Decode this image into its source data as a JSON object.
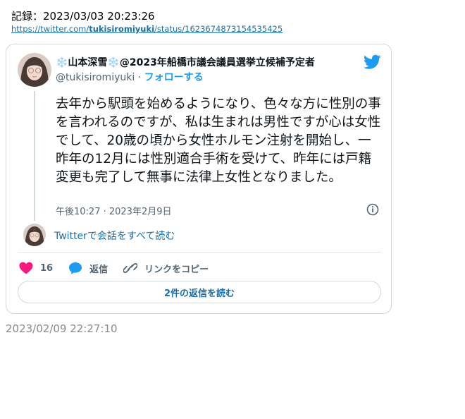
{
  "record": {
    "label": "記録：2023/03/03 20:23:26",
    "url_prefix": "https://twitter.com/",
    "url_user": "tukisiromiyuki",
    "url_suffix": "/status/1623674873154535425"
  },
  "tweet": {
    "display_name": "❄️山本深雪❄️@2023年船橋市議会議員選挙立候補予定者",
    "handle": "@tukisiromiyuki",
    "separator": " · ",
    "follow_label": "フォローする",
    "text": "去年から駅頭を始めるようになり、色々な方に性別の事を言われるのですが、私は生まれは男性ですが心は女性でして、20歳の頃から女性ホルモン注射を開始し、一昨年の12月には性別適合手術を受けて、昨年には戸籍変更も完了して無事に法律上女性となりました。",
    "timestamp": "午後10:27 · 2023年2月9日",
    "read_conversation": "Twitterで会話をすべて読む",
    "likes": "16",
    "reply_label": "返信",
    "copy_link_label": "リンクをコピー",
    "read_replies": "2件の返信を読む"
  },
  "footer_timestamp": "2023/02/09 22:27:10",
  "colors": {
    "accent": "#1d9bf0",
    "like": "#f91880",
    "link": "#1b6ea8"
  },
  "icons": [
    "twitter-bird-icon",
    "info-icon",
    "heart-icon",
    "reply-bubble-icon",
    "link-icon"
  ]
}
